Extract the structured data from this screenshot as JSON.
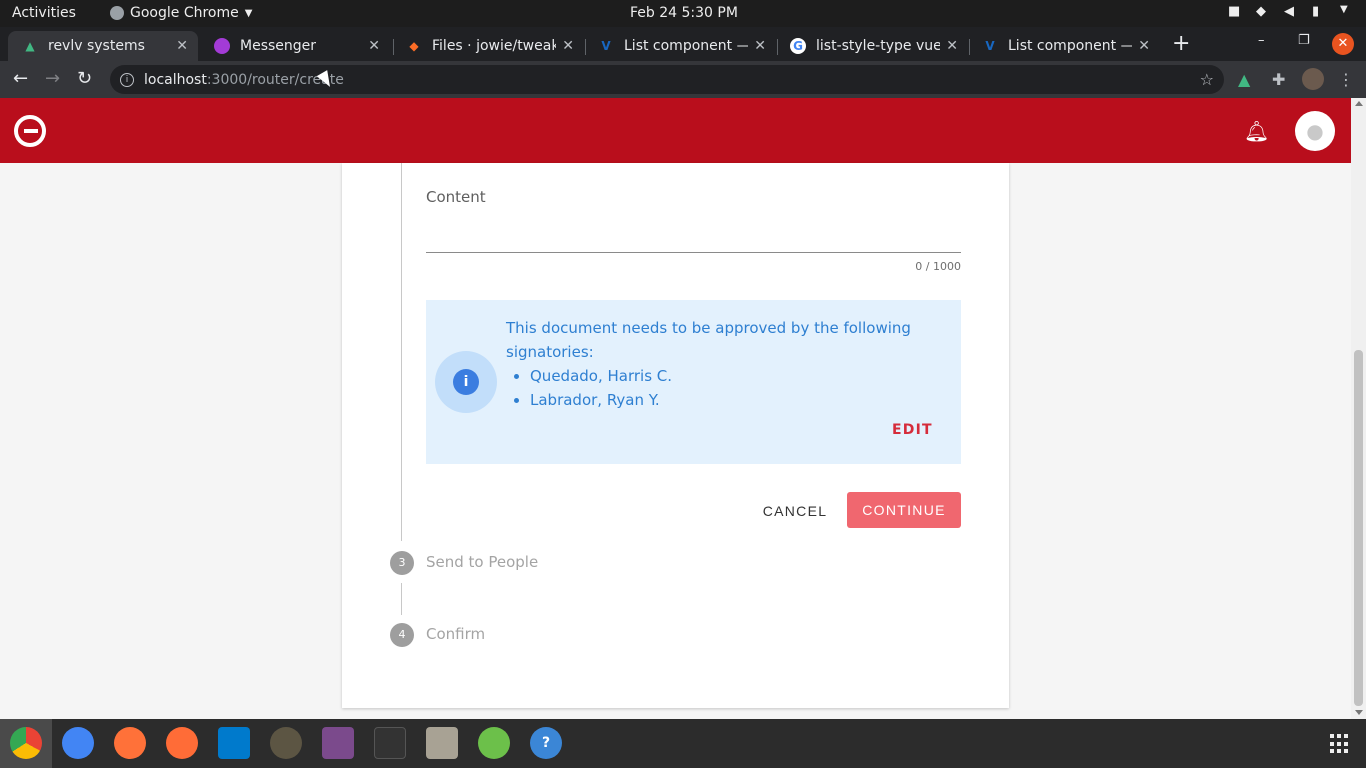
{
  "system_bar": {
    "activities": "Activities",
    "app_name": "Google Chrome",
    "clock": "Feb 24   5:30 PM"
  },
  "browser": {
    "tabs": [
      {
        "label": "revlv systems",
        "icon": "revlv-icon",
        "active": true
      },
      {
        "label": "Messenger",
        "icon": "messenger-icon"
      },
      {
        "label": "Files · jowie/tweak",
        "icon": "gitlab-icon"
      },
      {
        "label": "List component —",
        "icon": "vuetify-icon"
      },
      {
        "label": "list-style-type vuet",
        "icon": "google-icon"
      },
      {
        "label": "List component —",
        "icon": "vuetify-icon"
      }
    ],
    "url_host": "localhost",
    "url_path": ":3000/router/create"
  },
  "app": {
    "brand_color": "#b90e1c"
  },
  "form": {
    "content_label": "Content",
    "content_value": "",
    "counter": "0 / 1000",
    "alert_message": "This document needs to be approved by the following signatories:",
    "signatories": [
      "Quedado, Harris C.",
      "Labrador, Ryan Y."
    ],
    "edit_label": "EDIT",
    "cancel_label": "CANCEL",
    "continue_label": "CONTINUE"
  },
  "steps": [
    {
      "number": "3",
      "label": "Send to People"
    },
    {
      "number": "4",
      "label": "Confirm"
    }
  ],
  "dock": [
    "chrome-icon",
    "chromium-icon",
    "firefox-icon",
    "postman-icon",
    "vscode-icon",
    "gimp-icon",
    "video-icon",
    "terminal-icon",
    "files-icon",
    "network-icon",
    "help-icon"
  ]
}
